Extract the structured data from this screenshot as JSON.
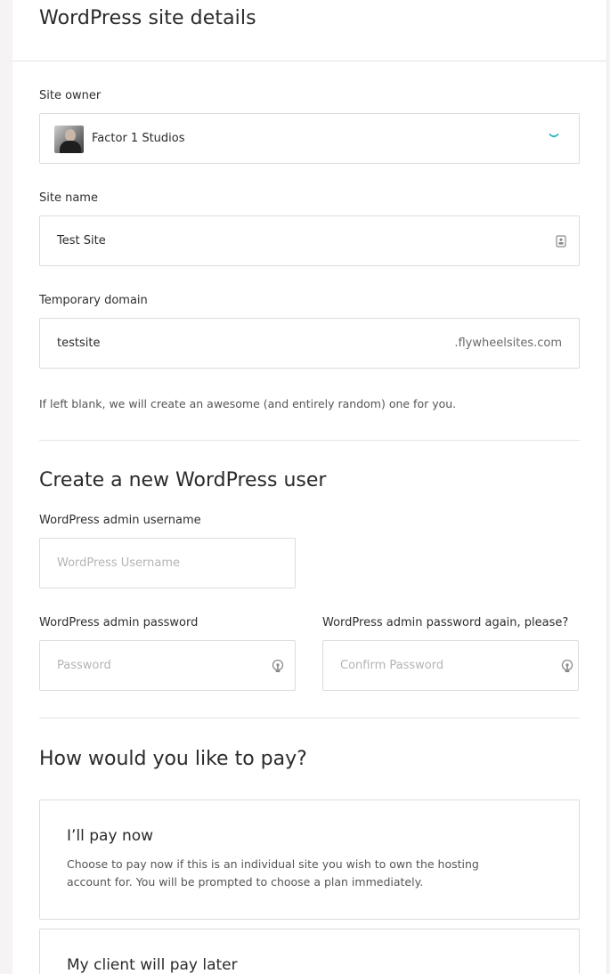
{
  "page": {
    "title": "WordPress site details"
  },
  "site_owner": {
    "label": "Site owner",
    "value": "Factor 1 Studios",
    "avatar": "avatar-photo-icon",
    "icon": "chevron-down-icon",
    "accent": "#2bb6c1"
  },
  "site_name": {
    "label": "Site name",
    "value": "Test Site",
    "icon": "contact-card-icon"
  },
  "temp_domain": {
    "label": "Temporary domain",
    "value": "testsite",
    "suffix": ".flywheelsites.com",
    "hint": "If left blank, we will create an awesome (and entirely random) one for you."
  },
  "wp_user": {
    "title": "Create a new WordPress user",
    "username_label": "WordPress admin username",
    "username_placeholder": "WordPress Username",
    "password_label": "WordPress admin password",
    "password_placeholder": "Password",
    "confirm_label": "WordPress admin password again, please?",
    "confirm_placeholder": "Confirm Password",
    "password_icon": "password-generate-icon"
  },
  "payment": {
    "title": "How would you like to pay?",
    "options": [
      {
        "title": "I’ll pay now",
        "description": "Choose to pay now if this is an individual site you wish to own the hosting account for. You will be prompted to choose a plan immediately."
      },
      {
        "title": "My client will pay later",
        "description": ""
      }
    ]
  }
}
